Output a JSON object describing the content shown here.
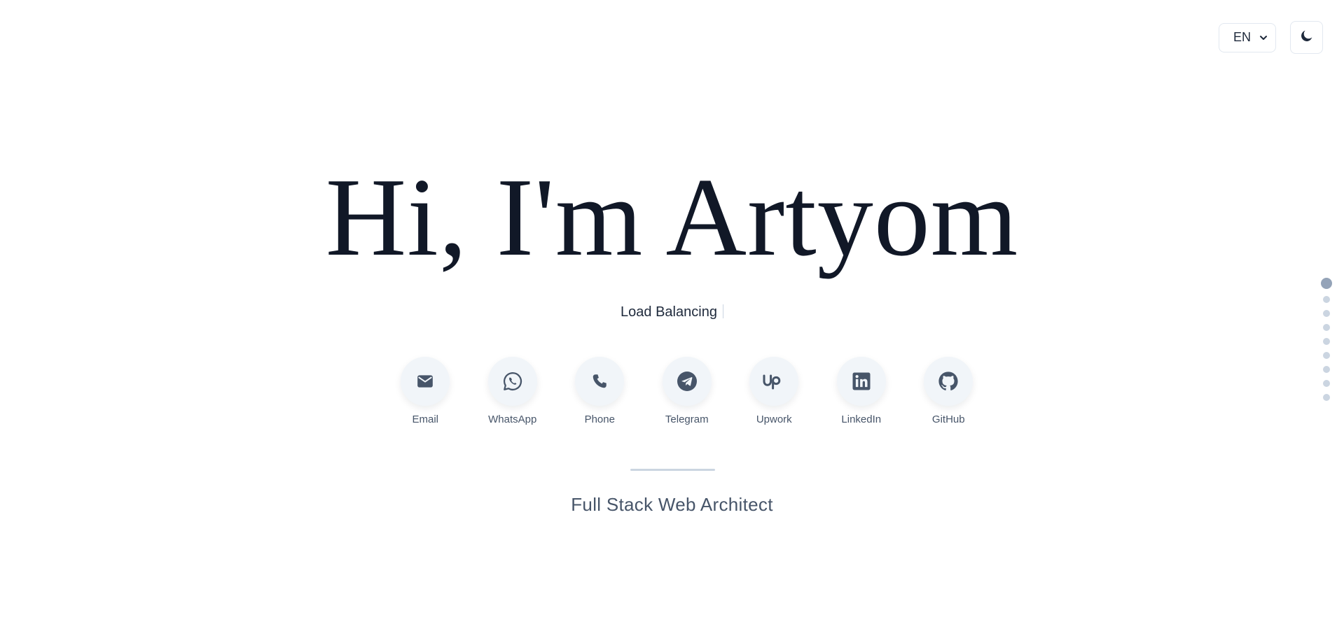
{
  "header": {
    "language": "EN",
    "theme_icon": "moon-icon"
  },
  "hero": {
    "title": "Hi, I'm Artyom",
    "typing_text": "Load Balancing",
    "subtitle": "Full Stack Web Architect"
  },
  "socials": [
    {
      "label": "Email",
      "icon": "email-icon"
    },
    {
      "label": "WhatsApp",
      "icon": "whatsapp-icon"
    },
    {
      "label": "Phone",
      "icon": "phone-icon"
    },
    {
      "label": "Telegram",
      "icon": "telegram-icon"
    },
    {
      "label": "Upwork",
      "icon": "upwork-icon"
    },
    {
      "label": "LinkedIn",
      "icon": "linkedin-icon"
    },
    {
      "label": "GitHub",
      "icon": "github-icon"
    }
  ],
  "section_nav": {
    "count": 9,
    "active_index": 0
  },
  "colors": {
    "icon": "#475569",
    "text_primary": "#111827",
    "text_muted": "#475569",
    "circle_bg": "#f1f5f9",
    "dot": "#cbd5e1",
    "dot_active": "#94a3b8"
  }
}
